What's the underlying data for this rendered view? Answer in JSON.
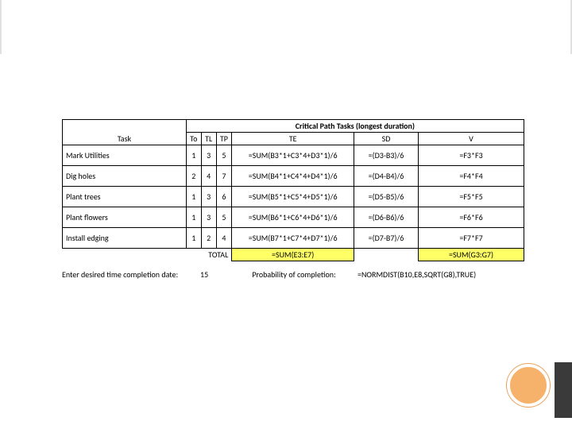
{
  "table": {
    "title": "Critical Path Tasks (longest duration)",
    "headers": {
      "task": "Task",
      "to": "To",
      "tl": "TL",
      "tp": "TP",
      "te": "TE",
      "sd": "SD",
      "v": "V"
    },
    "rows": [
      {
        "task": "Mark Utilities",
        "to": "1",
        "tl": "3",
        "tp": "5",
        "te": "=SUM(B3*1+C3*4+D3*1)/6",
        "sd": "=(D3-B3)/6",
        "v": "=F3*F3"
      },
      {
        "task": "Dig holes",
        "to": "2",
        "tl": "4",
        "tp": "7",
        "te": "=SUM(B4*1+C4*4+D4*1)/6",
        "sd": "=(D4-B4)/6",
        "v": "=F4*F4"
      },
      {
        "task": "Plant trees",
        "to": "1",
        "tl": "3",
        "tp": "6",
        "te": "=SUM(B5*1+C5*4+D5*1)/6",
        "sd": "=(D5-B5)/6",
        "v": "=F5*F5"
      },
      {
        "task": "Plant flowers",
        "to": "1",
        "tl": "3",
        "tp": "5",
        "te": "=SUM(B6*1+C6*4+D6*1)/6",
        "sd": "=(D6-B6)/6",
        "v": "=F6*F6"
      },
      {
        "task": "Install edging",
        "to": "1",
        "tl": "2",
        "tp": "4",
        "te": "=SUM(B7*1+C7*4+D7*1)/6",
        "sd": "=(D7-B7)/6",
        "v": "=F7*F7"
      }
    ],
    "total": {
      "label": "TOTAL",
      "te_sum": "=SUM(E3:E7)",
      "v_sum": "=SUM(G3:G7)"
    }
  },
  "footer": {
    "date_label": "Enter desired time completion date:",
    "date_value": "15",
    "prob_label": "Probability of completion:",
    "prob_formula": "=NORMDIST(B10,E8,SQRT(G8),TRUE)"
  }
}
